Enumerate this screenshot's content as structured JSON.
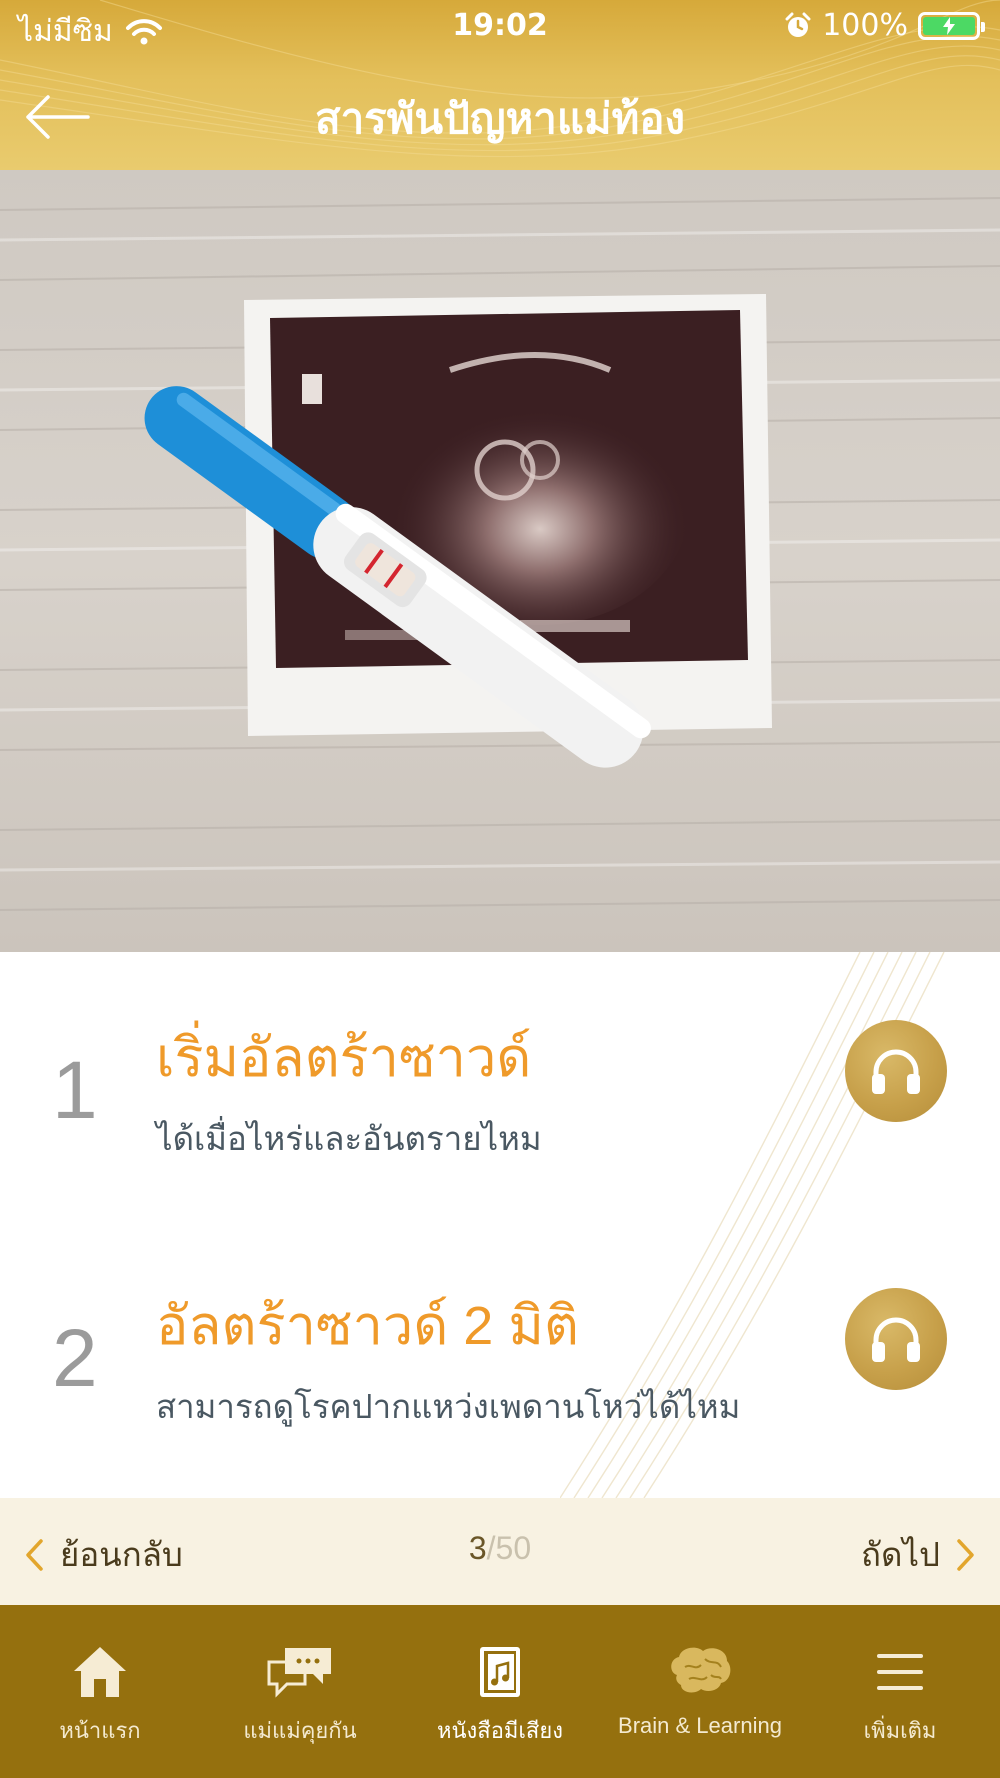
{
  "status_bar": {
    "carrier": "ไม่มีซิม",
    "time": "19:02",
    "battery": "100%"
  },
  "header": {
    "title": "สารพันปัญหาแม่ท้อง"
  },
  "hero": {
    "icon": "ultrasound-pregnancy-test-photo"
  },
  "items": [
    {
      "number": "1",
      "title": "เริ่มอัลตร้าซาวด์",
      "subtitle": "ได้เมื่อไหร่และอันตรายไหม"
    },
    {
      "number": "2",
      "title": "อัลตร้าซาวด์ 2 มิติ",
      "subtitle": "สามารถดูโรคปากแหว่งเพดานโหว่ได้ไหม"
    }
  ],
  "pager": {
    "prev_label": "ย้อนกลับ",
    "next_label": "ถัดไป",
    "current": "3",
    "total": "/50"
  },
  "tabs": [
    {
      "label": "หน้าแรก",
      "icon": "home-icon"
    },
    {
      "label": "แม่แม่คุยกัน",
      "icon": "chat-icon"
    },
    {
      "label": "หนังสือมีเสียง",
      "icon": "audio-book-icon"
    },
    {
      "label": "Brain & Learning",
      "icon": "brain-icon"
    },
    {
      "label": "เพิ่มเติม",
      "icon": "menu-icon"
    }
  ],
  "colors": {
    "header_gold": "#d6a93a",
    "title_orange": "#ef9a2a",
    "tabbar_brown": "#95700e",
    "pager_cream": "#f8f2e2",
    "battery_green": "#4cd964"
  }
}
